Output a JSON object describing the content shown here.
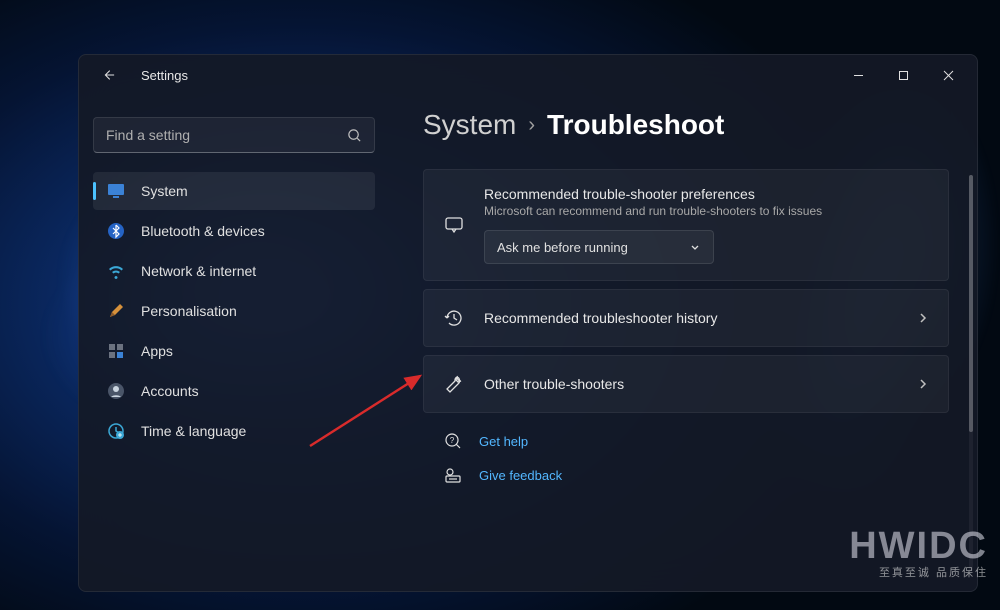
{
  "window": {
    "title": "Settings"
  },
  "search": {
    "placeholder": "Find a setting"
  },
  "sidebar": {
    "items": [
      {
        "label": "System",
        "active": true,
        "icon": "monitor"
      },
      {
        "label": "Bluetooth & devices",
        "active": false,
        "icon": "bluetooth"
      },
      {
        "label": "Network & internet",
        "active": false,
        "icon": "wifi"
      },
      {
        "label": "Personalisation",
        "active": false,
        "icon": "brush"
      },
      {
        "label": "Apps",
        "active": false,
        "icon": "apps"
      },
      {
        "label": "Accounts",
        "active": false,
        "icon": "account"
      },
      {
        "label": "Time & language",
        "active": false,
        "icon": "time"
      }
    ]
  },
  "breadcrumb": {
    "parent": "System",
    "current": "Troubleshoot"
  },
  "cards": {
    "preferences": {
      "title": "Recommended trouble-shooter preferences",
      "subtitle": "Microsoft can recommend and run trouble-shooters to fix issues",
      "dropdown_value": "Ask me before running"
    },
    "history": {
      "title": "Recommended troubleshooter history"
    },
    "other": {
      "title": "Other trouble-shooters"
    }
  },
  "footer": {
    "help": "Get help",
    "feedback": "Give feedback"
  },
  "watermark": {
    "big": "HWIDC",
    "small": "至真至诚 品质保住"
  }
}
